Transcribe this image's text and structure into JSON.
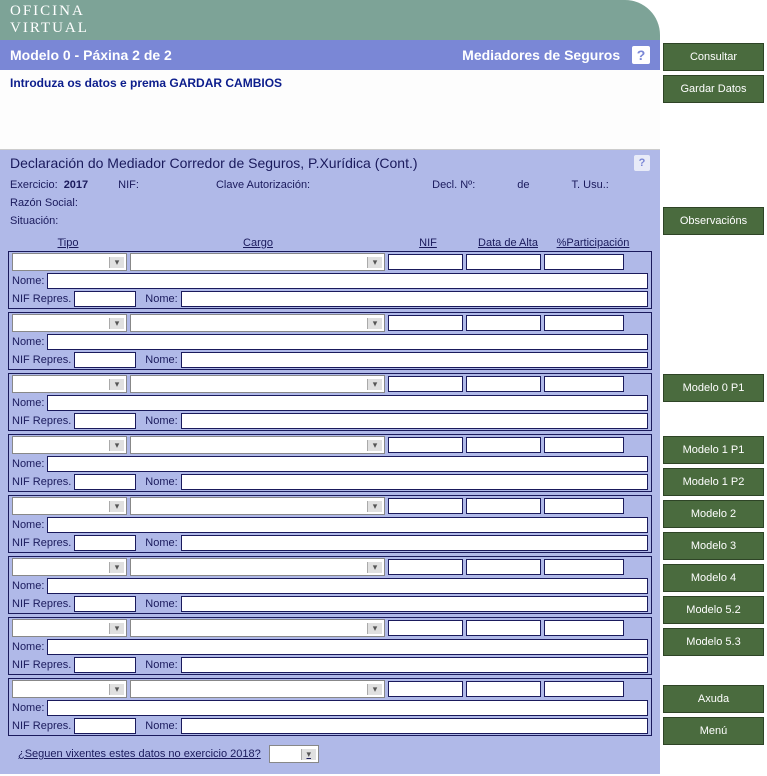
{
  "logo": {
    "line1": "OFICINA",
    "line2": "VIRTUAL"
  },
  "titlebar": {
    "left": "Modelo 0 - Páxina 2 de 2",
    "right": "Mediadores de Seguros"
  },
  "instruction": "Introduza os datos e prema GARDAR CAMBIOS",
  "subtitle": "Declaración do Mediador Corredor de Seguros, P.Xurídica (Cont.)",
  "meta": {
    "exercicio_lbl": "Exercicio:",
    "exercicio_val": "2017",
    "nif_lbl": "NIF:",
    "clave_lbl": "Clave Autorización:",
    "decl_lbl": "Decl. Nº:",
    "de_lbl": "de",
    "tusu_lbl": "T. Usu.:",
    "razon_lbl": "Razón Social:",
    "situacion_lbl": "Situación:"
  },
  "headers": {
    "tipo": "Tipo",
    "cargo": "Cargo",
    "nif": "NIF",
    "data": "Data de Alta",
    "part": "%Participación"
  },
  "row_labels": {
    "nome": "Nome:",
    "nifrepres": "NIF Repres.",
    "nome2": "Nome:"
  },
  "footer_question": "¿Seguen vixentes estes datos no exercicio 2018?",
  "sidebar": {
    "consultar": "Consultar",
    "gardar": "Gardar Datos",
    "observacions": "Observacións",
    "m0p1": "Modelo 0 P1",
    "m1p1": "Modelo 1 P1",
    "m1p2": "Modelo 1 P2",
    "m2": "Modelo 2",
    "m3": "Modelo 3",
    "m4": "Modelo 4",
    "m52": "Modelo 5.2",
    "m53": "Modelo 5.3",
    "axuda": "Axuda",
    "menu": "Menú"
  }
}
